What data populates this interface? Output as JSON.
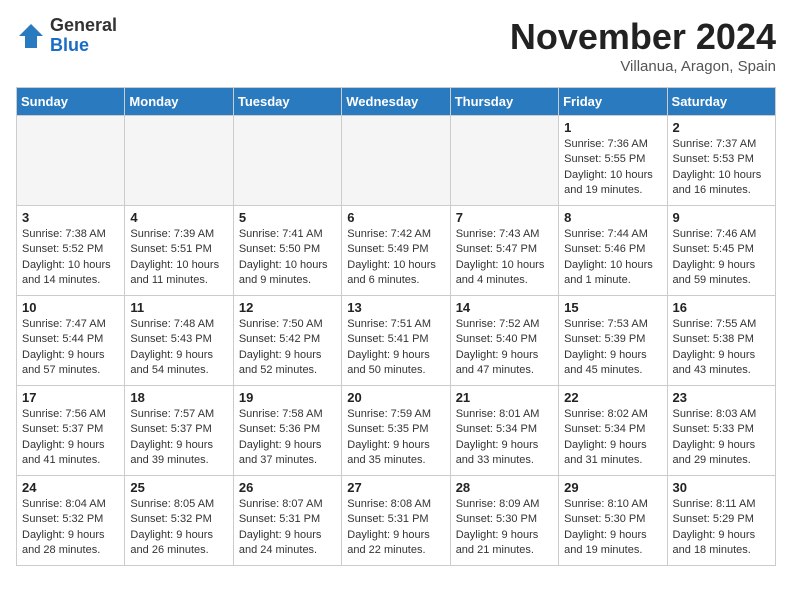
{
  "header": {
    "logo_general": "General",
    "logo_blue": "Blue",
    "month": "November 2024",
    "location": "Villanua, Aragon, Spain"
  },
  "weekdays": [
    "Sunday",
    "Monday",
    "Tuesday",
    "Wednesday",
    "Thursday",
    "Friday",
    "Saturday"
  ],
  "weeks": [
    [
      {
        "day": "",
        "info": ""
      },
      {
        "day": "",
        "info": ""
      },
      {
        "day": "",
        "info": ""
      },
      {
        "day": "",
        "info": ""
      },
      {
        "day": "",
        "info": ""
      },
      {
        "day": "1",
        "info": "Sunrise: 7:36 AM\nSunset: 5:55 PM\nDaylight: 10 hours\nand 19 minutes."
      },
      {
        "day": "2",
        "info": "Sunrise: 7:37 AM\nSunset: 5:53 PM\nDaylight: 10 hours\nand 16 minutes."
      }
    ],
    [
      {
        "day": "3",
        "info": "Sunrise: 7:38 AM\nSunset: 5:52 PM\nDaylight: 10 hours\nand 14 minutes."
      },
      {
        "day": "4",
        "info": "Sunrise: 7:39 AM\nSunset: 5:51 PM\nDaylight: 10 hours\nand 11 minutes."
      },
      {
        "day": "5",
        "info": "Sunrise: 7:41 AM\nSunset: 5:50 PM\nDaylight: 10 hours\nand 9 minutes."
      },
      {
        "day": "6",
        "info": "Sunrise: 7:42 AM\nSunset: 5:49 PM\nDaylight: 10 hours\nand 6 minutes."
      },
      {
        "day": "7",
        "info": "Sunrise: 7:43 AM\nSunset: 5:47 PM\nDaylight: 10 hours\nand 4 minutes."
      },
      {
        "day": "8",
        "info": "Sunrise: 7:44 AM\nSunset: 5:46 PM\nDaylight: 10 hours\nand 1 minute."
      },
      {
        "day": "9",
        "info": "Sunrise: 7:46 AM\nSunset: 5:45 PM\nDaylight: 9 hours\nand 59 minutes."
      }
    ],
    [
      {
        "day": "10",
        "info": "Sunrise: 7:47 AM\nSunset: 5:44 PM\nDaylight: 9 hours\nand 57 minutes."
      },
      {
        "day": "11",
        "info": "Sunrise: 7:48 AM\nSunset: 5:43 PM\nDaylight: 9 hours\nand 54 minutes."
      },
      {
        "day": "12",
        "info": "Sunrise: 7:50 AM\nSunset: 5:42 PM\nDaylight: 9 hours\nand 52 minutes."
      },
      {
        "day": "13",
        "info": "Sunrise: 7:51 AM\nSunset: 5:41 PM\nDaylight: 9 hours\nand 50 minutes."
      },
      {
        "day": "14",
        "info": "Sunrise: 7:52 AM\nSunset: 5:40 PM\nDaylight: 9 hours\nand 47 minutes."
      },
      {
        "day": "15",
        "info": "Sunrise: 7:53 AM\nSunset: 5:39 PM\nDaylight: 9 hours\nand 45 minutes."
      },
      {
        "day": "16",
        "info": "Sunrise: 7:55 AM\nSunset: 5:38 PM\nDaylight: 9 hours\nand 43 minutes."
      }
    ],
    [
      {
        "day": "17",
        "info": "Sunrise: 7:56 AM\nSunset: 5:37 PM\nDaylight: 9 hours\nand 41 minutes."
      },
      {
        "day": "18",
        "info": "Sunrise: 7:57 AM\nSunset: 5:37 PM\nDaylight: 9 hours\nand 39 minutes."
      },
      {
        "day": "19",
        "info": "Sunrise: 7:58 AM\nSunset: 5:36 PM\nDaylight: 9 hours\nand 37 minutes."
      },
      {
        "day": "20",
        "info": "Sunrise: 7:59 AM\nSunset: 5:35 PM\nDaylight: 9 hours\nand 35 minutes."
      },
      {
        "day": "21",
        "info": "Sunrise: 8:01 AM\nSunset: 5:34 PM\nDaylight: 9 hours\nand 33 minutes."
      },
      {
        "day": "22",
        "info": "Sunrise: 8:02 AM\nSunset: 5:34 PM\nDaylight: 9 hours\nand 31 minutes."
      },
      {
        "day": "23",
        "info": "Sunrise: 8:03 AM\nSunset: 5:33 PM\nDaylight: 9 hours\nand 29 minutes."
      }
    ],
    [
      {
        "day": "24",
        "info": "Sunrise: 8:04 AM\nSunset: 5:32 PM\nDaylight: 9 hours\nand 28 minutes."
      },
      {
        "day": "25",
        "info": "Sunrise: 8:05 AM\nSunset: 5:32 PM\nDaylight: 9 hours\nand 26 minutes."
      },
      {
        "day": "26",
        "info": "Sunrise: 8:07 AM\nSunset: 5:31 PM\nDaylight: 9 hours\nand 24 minutes."
      },
      {
        "day": "27",
        "info": "Sunrise: 8:08 AM\nSunset: 5:31 PM\nDaylight: 9 hours\nand 22 minutes."
      },
      {
        "day": "28",
        "info": "Sunrise: 8:09 AM\nSunset: 5:30 PM\nDaylight: 9 hours\nand 21 minutes."
      },
      {
        "day": "29",
        "info": "Sunrise: 8:10 AM\nSunset: 5:30 PM\nDaylight: 9 hours\nand 19 minutes."
      },
      {
        "day": "30",
        "info": "Sunrise: 8:11 AM\nSunset: 5:29 PM\nDaylight: 9 hours\nand 18 minutes."
      }
    ]
  ]
}
